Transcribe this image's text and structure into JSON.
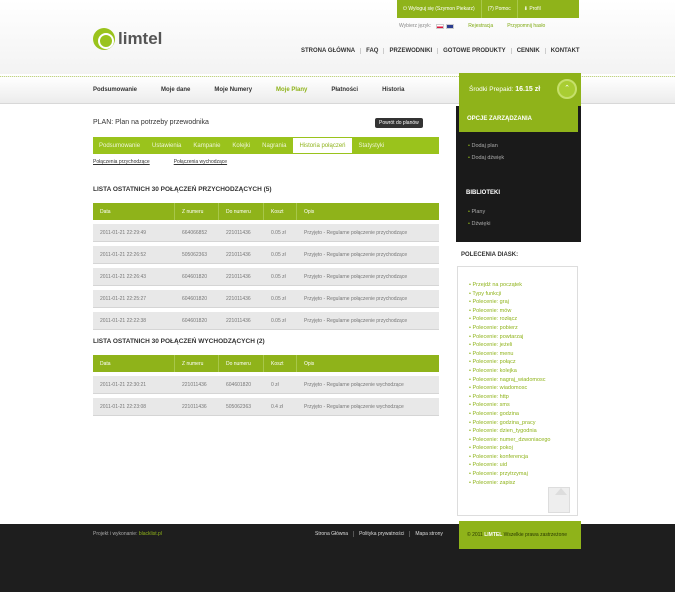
{
  "top_strip": {
    "login": "Wyloguj się (Szymon Piekarz)",
    "help": "(?) Pomoc",
    "profile": "Profil"
  },
  "sub_strip": {
    "choose_language": "Wybierz język:",
    "register": "Rejestracja",
    "remind_password": "Przypomnij hasło"
  },
  "logo": {
    "text": "limtel"
  },
  "main_nav": [
    "STRONA GŁÓWNA",
    "FAQ",
    "PRZEWODNIKI",
    "GOTOWE PRODUKTY",
    "CENNIK",
    "KONTAKT"
  ],
  "tabs": [
    {
      "label": "Podsumowanie",
      "active": false
    },
    {
      "label": "Moje dane",
      "active": false
    },
    {
      "label": "Moje Numery",
      "active": false
    },
    {
      "label": "Moje Plany",
      "active": true
    },
    {
      "label": "Płatności",
      "active": false
    },
    {
      "label": "Historia",
      "active": false
    }
  ],
  "balance": {
    "label": "Środki Prepaid:",
    "value": "16.15 zł"
  },
  "plan": {
    "title": "PLAN: Plan na potrzeby przewodnika",
    "back_button": "Powrót do planów"
  },
  "subtabs": [
    {
      "label": "Podsumowanie",
      "active": false
    },
    {
      "label": "Ustawienia",
      "active": false
    },
    {
      "label": "Kampanie",
      "active": false
    },
    {
      "label": "Kolejki",
      "active": false
    },
    {
      "label": "Nagrania",
      "active": false
    },
    {
      "label": "Historia połączeń",
      "active": true
    },
    {
      "label": "Statystyki",
      "active": false
    }
  ],
  "sublinks": [
    "Połączenia przychodzące",
    "Połączenia wychodzące"
  ],
  "incoming": {
    "title": "LISTA OSTATNICH 30 POŁĄCZEŃ PRZYCHODZĄCYCH (5)",
    "headers": [
      "Data",
      "Z numeru",
      "Do numeru",
      "Koszt",
      "Opis"
    ],
    "rows": [
      [
        "2011-01-21 22:29:49",
        "664066852",
        "221011436",
        "0.05 zł",
        "Przyjęto - Regularne połączenie przychodzące"
      ],
      [
        "2011-01-21 22:26:52",
        "505062363",
        "221011436",
        "0.05 zł",
        "Przyjęto - Regularne połączenie przychodzące"
      ],
      [
        "2011-01-21 22:26:43",
        "604601820",
        "221011436",
        "0.05 zł",
        "Przyjęto - Regularne połączenie przychodzące"
      ],
      [
        "2011-01-21 22:25:27",
        "604601820",
        "221011436",
        "0.05 zł",
        "Przyjęto - Regularne połączenie przychodzące"
      ],
      [
        "2011-01-21 22:22:38",
        "604601820",
        "221011436",
        "0.05 zł",
        "Przyjęto - Regularne połączenie przychodzące"
      ]
    ]
  },
  "outgoing": {
    "title": "LISTA OSTATNICH 30 POŁĄCZEŃ WYCHODZĄCYCH (2)",
    "headers": [
      "Data",
      "Z numeru",
      "Do numeru",
      "Koszt",
      "Opis"
    ],
    "rows": [
      [
        "2011-01-21 22:30:21",
        "221011436",
        "604601820",
        "0 zł",
        "Przyjęto - Regularne połączenie wychodzące"
      ],
      [
        "2011-01-21 22:23:08",
        "221011436",
        "505062363",
        "0.4 zł",
        "Przyjęto - Regularne połączenie wychodzące"
      ]
    ]
  },
  "sidebar": {
    "options_title": "OPCJE ZARZĄDZANIA",
    "options": [
      "Dodaj plan",
      "Dodaj dźwięk"
    ],
    "libraries_title": "BIBLIOTEKI",
    "libraries": [
      "Plany",
      "Dźwięki"
    ],
    "commands_title": "POLECENIA DIASK:",
    "commands": [
      "Przejdź na początek",
      "Typy funkcji",
      "Polecenie: graj",
      "Polecenie: mów",
      "Polecenie: rozłącz",
      "Polecenie: pobierz",
      "Polecenie: powtarzaj",
      "Polecenie: jeżeli",
      "Polecenie: menu",
      "Polecenie: połącz",
      "Polecenie: kolejka",
      "Polecenie: nagraj_wiadomosc",
      "Polecenie: wiadomosc",
      "Polecenie: http",
      "Polecenie: sms",
      "Polecenie: godzina",
      "Polecenie: godzina_pracy",
      "Polecenie: dzien_tygodnia",
      "Polecenie: numer_dzwoniacego",
      "Polecenie: pokoj",
      "Polecenie: konferencja",
      "Polecenie: uid",
      "Polecenie: przytrzymaj",
      "Polecenie: zapisz"
    ]
  },
  "footer": {
    "made_by": "Projekt i wykonanie:",
    "made_by_link": "blacklist.pl",
    "links": [
      "Strona Główna",
      "Polityka prywatności",
      "Mapa strony"
    ],
    "copyright_prefix": "© 2011",
    "copyright_brand": "LIMTEL",
    "copyright_suffix": "Wszelkie prawa zastrzeżone"
  },
  "colors": {
    "accent": "#8fb31a",
    "dark": "#1e1e1e"
  }
}
